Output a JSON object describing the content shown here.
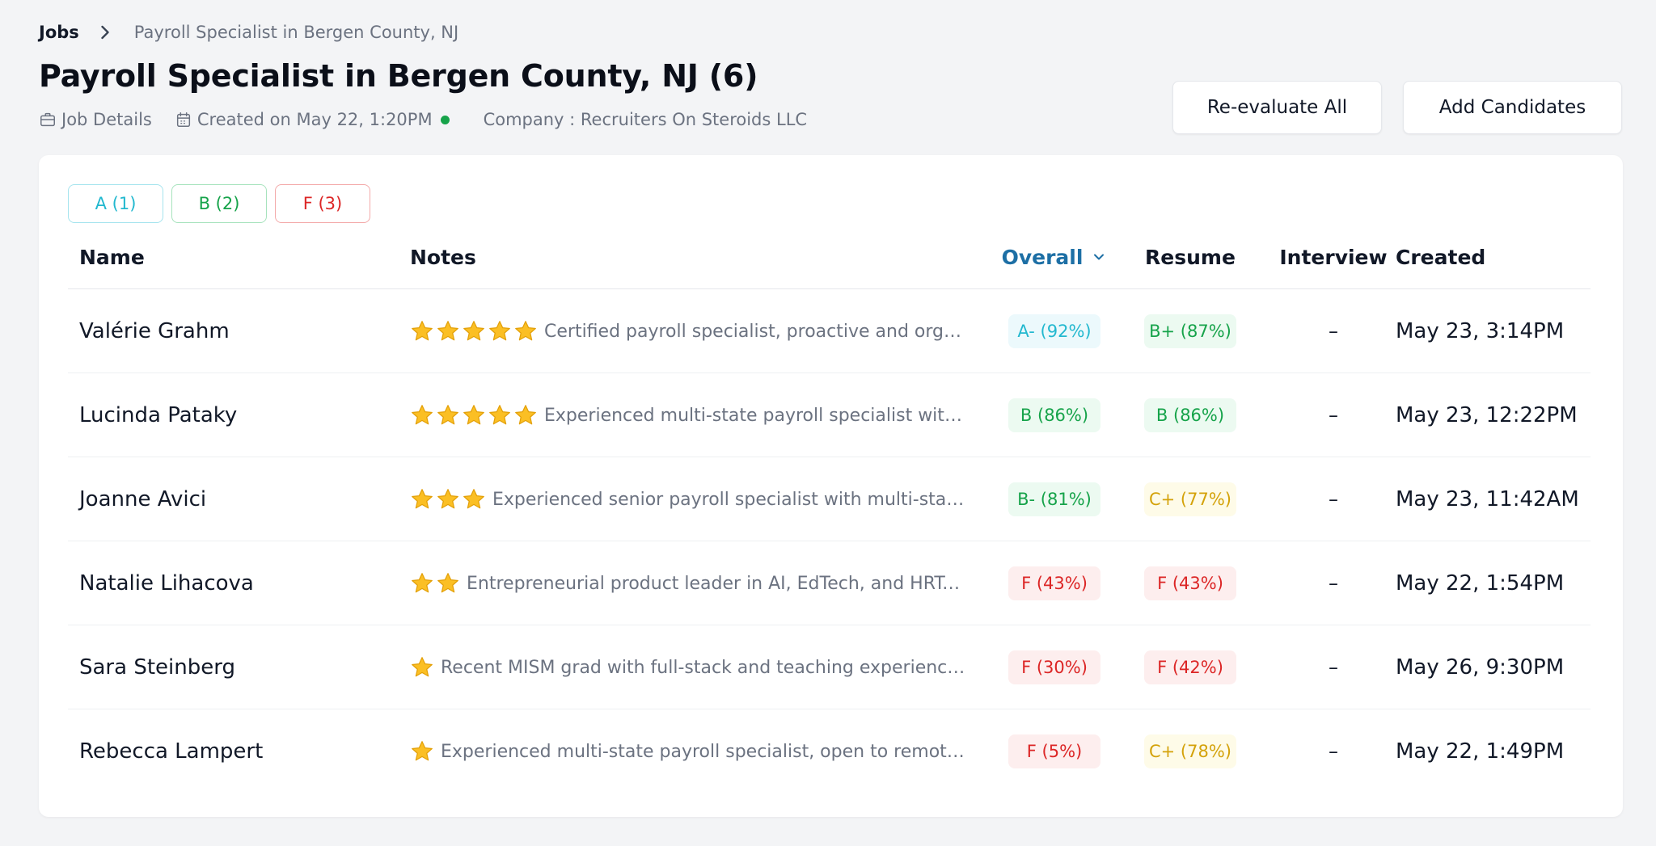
{
  "breadcrumb": {
    "root": "Jobs",
    "current": "Payroll Specialist in Bergen County, NJ"
  },
  "page": {
    "title": "Payroll Specialist in Bergen County, NJ (6)"
  },
  "meta": {
    "job_details": "Job Details",
    "created": "Created on May 22, 1:20PM",
    "company": "Company : Recruiters On Steroids LLC",
    "status_color": "#16a34a"
  },
  "actions": {
    "reevaluate": "Re-evaluate All",
    "add_candidates": "Add Candidates"
  },
  "filters": [
    {
      "label": "A (1)",
      "grade": "A"
    },
    {
      "label": "B (2)",
      "grade": "B"
    },
    {
      "label": "F (3)",
      "grade": "F"
    }
  ],
  "columns": {
    "name": "Name",
    "notes": "Notes",
    "overall": "Overall",
    "resume": "Resume",
    "interview": "Interview",
    "created": "Created"
  },
  "colors": {
    "grade_a": "#22b8cf",
    "grade_b": "#16a34a",
    "grade_c": "#d4a20a",
    "grade_f": "#dc2626",
    "sort_accent": "#1d6fa5"
  },
  "candidates": [
    {
      "name": "Valérie Grahm",
      "stars": 5,
      "note": "Certified payroll specialist, proactive and organiz...",
      "overall": "A- (92%)",
      "overall_grade": "a",
      "resume": "B+ (87%)",
      "resume_grade": "b",
      "interview": "–",
      "created": "May 23, 3:14PM"
    },
    {
      "name": "Lucinda Pataky",
      "stars": 5,
      "note": "Experienced multi-state payroll specialist with A...",
      "overall": "B (86%)",
      "overall_grade": "b",
      "resume": "B (86%)",
      "resume_grade": "b",
      "interview": "–",
      "created": "May 23, 12:22PM"
    },
    {
      "name": "Joanne Avici",
      "stars": 3,
      "note": "Experienced senior payroll specialist with multi-state a...",
      "overall": "B- (81%)",
      "overall_grade": "b",
      "resume": "C+ (77%)",
      "resume_grade": "c",
      "interview": "–",
      "created": "May 23, 11:42AM"
    },
    {
      "name": "Natalie Lihacova",
      "stars": 2,
      "note": "Entrepreneurial product leader in AI, EdTech, and HRTech ...",
      "overall": "F (43%)",
      "overall_grade": "f",
      "resume": "F (43%)",
      "resume_grade": "f",
      "interview": "–",
      "created": "May 22, 1:54PM"
    },
    {
      "name": "Sara Steinberg",
      "stars": 1,
      "note": "Recent MISM grad with full-stack and teaching experience, B...",
      "overall": "F (30%)",
      "overall_grade": "f",
      "resume": "F (42%)",
      "resume_grade": "f",
      "interview": "–",
      "created": "May 26, 9:30PM"
    },
    {
      "name": "Rebecca Lampert",
      "stars": 1,
      "note": "Experienced multi-state payroll specialist, open to remote or ...",
      "overall": "F (5%)",
      "overall_grade": "f",
      "resume": "C+ (78%)",
      "resume_grade": "c",
      "interview": "–",
      "created": "May 22, 1:49PM"
    }
  ]
}
